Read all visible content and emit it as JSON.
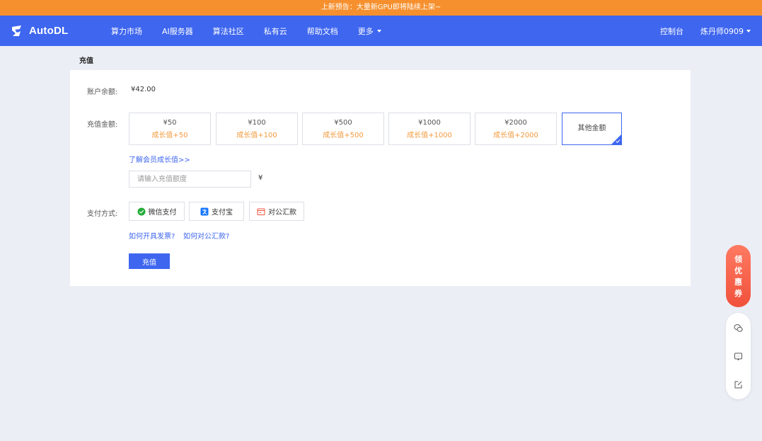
{
  "banner": {
    "text": "上新预告：大量新GPU即将陆续上架~"
  },
  "nav": {
    "brand": "AutoDL",
    "links": [
      "算力市场",
      "AI服务器",
      "算法社区",
      "私有云",
      "帮助文档",
      "更多"
    ],
    "console": "控制台",
    "user": "炼丹师0909"
  },
  "page": {
    "title": "充值"
  },
  "balance": {
    "label": "账户余额:",
    "value": "¥42.00"
  },
  "recharge": {
    "label": "充值金额:",
    "options": [
      {
        "price": "¥50",
        "growth": "成长值+50"
      },
      {
        "price": "¥100",
        "growth": "成长值+100"
      },
      {
        "price": "¥500",
        "growth": "成长值+500"
      },
      {
        "price": "¥1000",
        "growth": "成长值+1000"
      },
      {
        "price": "¥2000",
        "growth": "成长值+2000"
      }
    ],
    "other": "其他金额",
    "growth_link": "了解会员成长值>>",
    "input_placeholder": "请输入充值额度",
    "currency": "¥"
  },
  "payment": {
    "label": "支付方式:",
    "methods": [
      "微信支付",
      "支付宝",
      "对公汇款"
    ],
    "invoice_link": "如何开具发票?",
    "transfer_link": "如何对公汇款?"
  },
  "submit": {
    "label": "充值"
  },
  "float": {
    "coupon": [
      "领",
      "优",
      "惠",
      "券"
    ]
  },
  "colors": {
    "primary": "#3e66ef",
    "banner": "#f6902e",
    "growth": "#f39a3d",
    "coupon": "#f0513b"
  }
}
